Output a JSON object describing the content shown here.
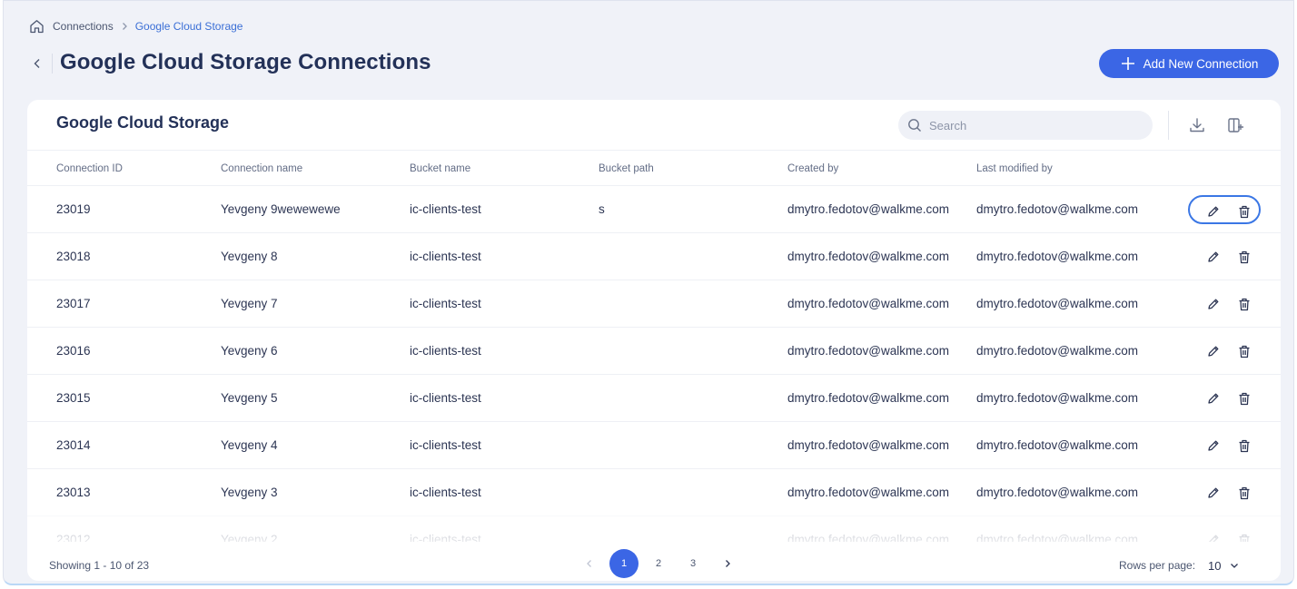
{
  "breadcrumb": {
    "items": [
      "Connections",
      "Google Cloud Storage"
    ]
  },
  "header": {
    "title": "Google Cloud Storage Connections",
    "add_button_label": "Add New Connection"
  },
  "card": {
    "title": "Google Cloud Storage",
    "search_placeholder": "Search"
  },
  "table": {
    "columns": [
      "Connection ID",
      "Connection name",
      "Bucket name",
      "Bucket path",
      "Created by",
      "Last modified by"
    ],
    "rows": [
      {
        "id": "23019",
        "name": "Yevgeny 9wewewewe",
        "bucket": "ic-clients-test",
        "path": "s",
        "created_by": "dmytro.fedotov@walkme.com",
        "modified_by": "dmytro.fedotov@walkme.com"
      },
      {
        "id": "23018",
        "name": "Yevgeny 8",
        "bucket": "ic-clients-test",
        "path": "",
        "created_by": "dmytro.fedotov@walkme.com",
        "modified_by": "dmytro.fedotov@walkme.com"
      },
      {
        "id": "23017",
        "name": "Yevgeny 7",
        "bucket": "ic-clients-test",
        "path": "",
        "created_by": "dmytro.fedotov@walkme.com",
        "modified_by": "dmytro.fedotov@walkme.com"
      },
      {
        "id": "23016",
        "name": "Yevgeny 6",
        "bucket": "ic-clients-test",
        "path": "",
        "created_by": "dmytro.fedotov@walkme.com",
        "modified_by": "dmytro.fedotov@walkme.com"
      },
      {
        "id": "23015",
        "name": "Yevgeny 5",
        "bucket": "ic-clients-test",
        "path": "",
        "created_by": "dmytro.fedotov@walkme.com",
        "modified_by": "dmytro.fedotov@walkme.com"
      },
      {
        "id": "23014",
        "name": "Yevgeny 4",
        "bucket": "ic-clients-test",
        "path": "",
        "created_by": "dmytro.fedotov@walkme.com",
        "modified_by": "dmytro.fedotov@walkme.com"
      },
      {
        "id": "23013",
        "name": "Yevgeny 3",
        "bucket": "ic-clients-test",
        "path": "",
        "created_by": "dmytro.fedotov@walkme.com",
        "modified_by": "dmytro.fedotov@walkme.com"
      },
      {
        "id": "23012",
        "name": "Yevgeny 2",
        "bucket": "ic-clients-test",
        "path": "",
        "created_by": "dmytro.fedotov@walkme.com",
        "modified_by": "dmytro.fedotov@walkme.com"
      }
    ],
    "icons": {
      "edit": "pencil-icon",
      "delete": "trash-icon"
    }
  },
  "footer": {
    "showing": "Showing 1 - 10 of 23",
    "pages": [
      "1",
      "2",
      "3"
    ],
    "current_page": "1",
    "rows_per_page_label": "Rows per page:",
    "rows_per_page_value": "10"
  },
  "colors": {
    "accent": "#3b66e5",
    "background": "#f0f2f8",
    "title": "#233158"
  }
}
